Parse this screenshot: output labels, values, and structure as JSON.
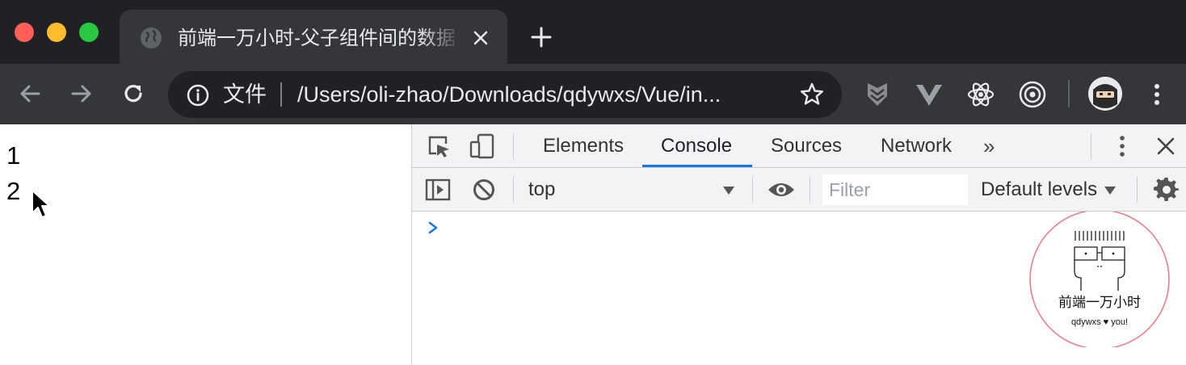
{
  "browser": {
    "tab": {
      "title": "前端一万小时-父子组件间的数据"
    },
    "omnibox": {
      "scheme_label": "文件",
      "url": "/Users/oli-zhao/Downloads/qdywxs/Vue/in..."
    }
  },
  "page": {
    "lines": [
      "1",
      "2"
    ]
  },
  "devtools": {
    "tabs": [
      "Elements",
      "Console",
      "Sources",
      "Network"
    ],
    "active_tab": "Console",
    "more_label": "»",
    "context": "top",
    "filter_placeholder": "Filter",
    "levels_label": "Default levels",
    "prompt_color": "#1a73e8"
  },
  "watermark": {
    "title": "前端一万小时",
    "subtitle": "qdywxs ♥ you!",
    "ring_color": "#e8808a"
  }
}
